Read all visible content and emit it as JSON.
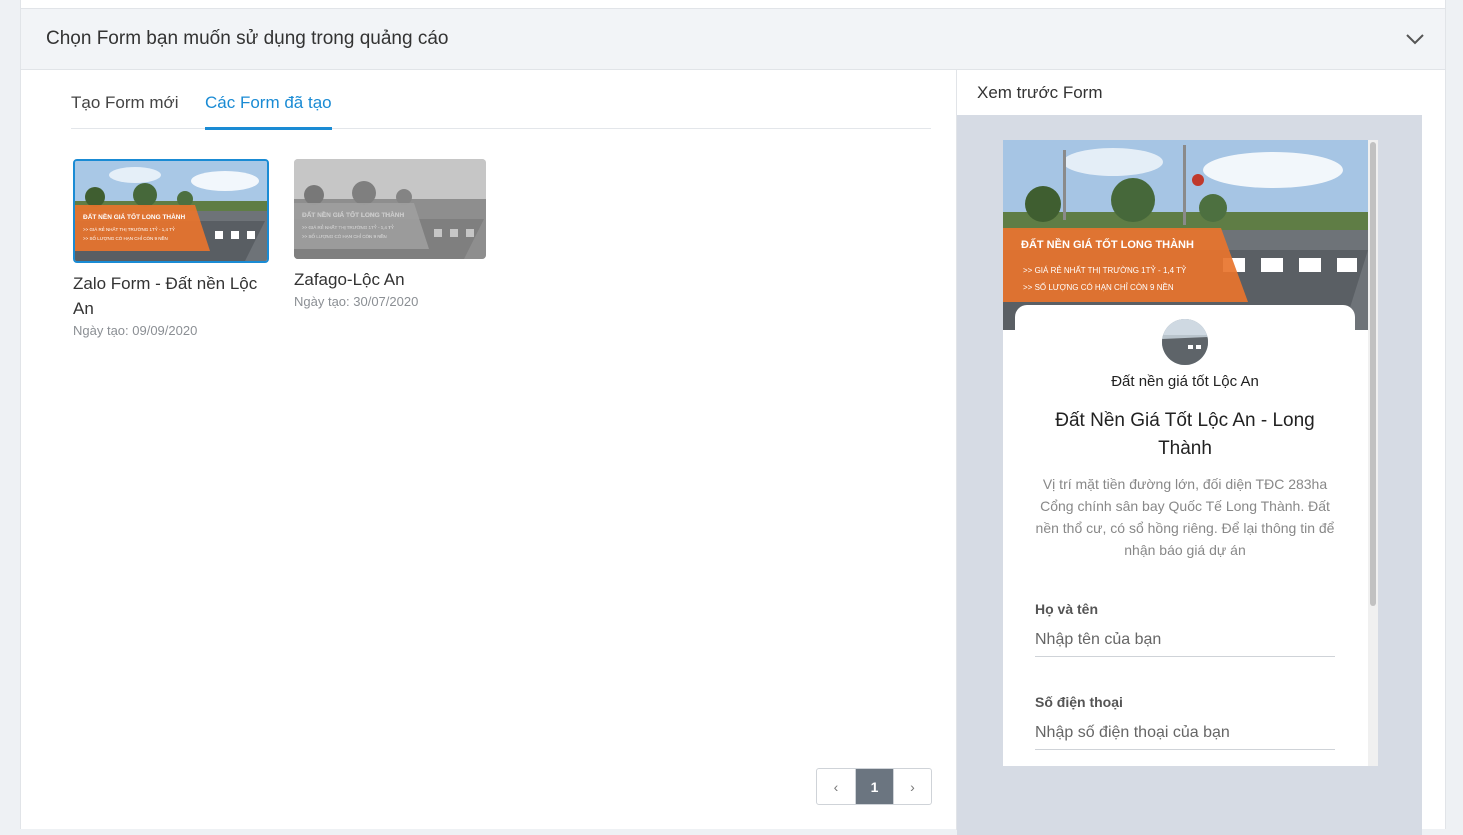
{
  "header": {
    "title": "Chọn Form bạn muốn sử dụng trong quảng cáo"
  },
  "tabs": [
    {
      "label": "Tạo Form mới",
      "active": false
    },
    {
      "label": "Các Form đã tạo",
      "active": true
    }
  ],
  "forms": [
    {
      "name": "Zalo Form - Đất nền Lộc An",
      "date": "Ngày tạo: 09/09/2020",
      "selected": true
    },
    {
      "name": "Zafago-Lộc An",
      "date": "Ngày tạo: 30/07/2020",
      "selected": false
    }
  ],
  "banner": {
    "headline": "ĐẤT NỀN GIÁ TỐT LONG THÀNH",
    "line1": ">> GIÁ RẺ NHẤT THỊ TRƯỜNG 1TỶ - 1,4 TỶ",
    "line2": ">> SỐ LƯỢNG CÓ HẠN CHỈ CÒN 9 NỀN"
  },
  "pagination": {
    "prev": "‹",
    "current": "1",
    "next": "›"
  },
  "preview": {
    "title": "Xem trước Form",
    "page_name": "Đất nền giá tốt Lộc An",
    "headline": "Đất Nền Giá Tốt Lộc An - Long Thành",
    "description": "Vị trí mặt tiền đường lớn, đối diện TĐC 283ha Cổng chính sân bay Quốc Tế Long Thành. Đất nền thổ cư, có sổ hồng riêng. Để lại thông tin để nhận báo giá dự án",
    "fields": [
      {
        "label": "Họ và tên",
        "placeholder": "Nhập tên của bạn"
      },
      {
        "label": "Số điện thoại",
        "placeholder": "Nhập số điện thoại của bạn"
      }
    ]
  },
  "colors": {
    "accent": "#1a8bd4",
    "banner_orange": "#e8742c",
    "preview_bg": "#d6dbe4"
  }
}
